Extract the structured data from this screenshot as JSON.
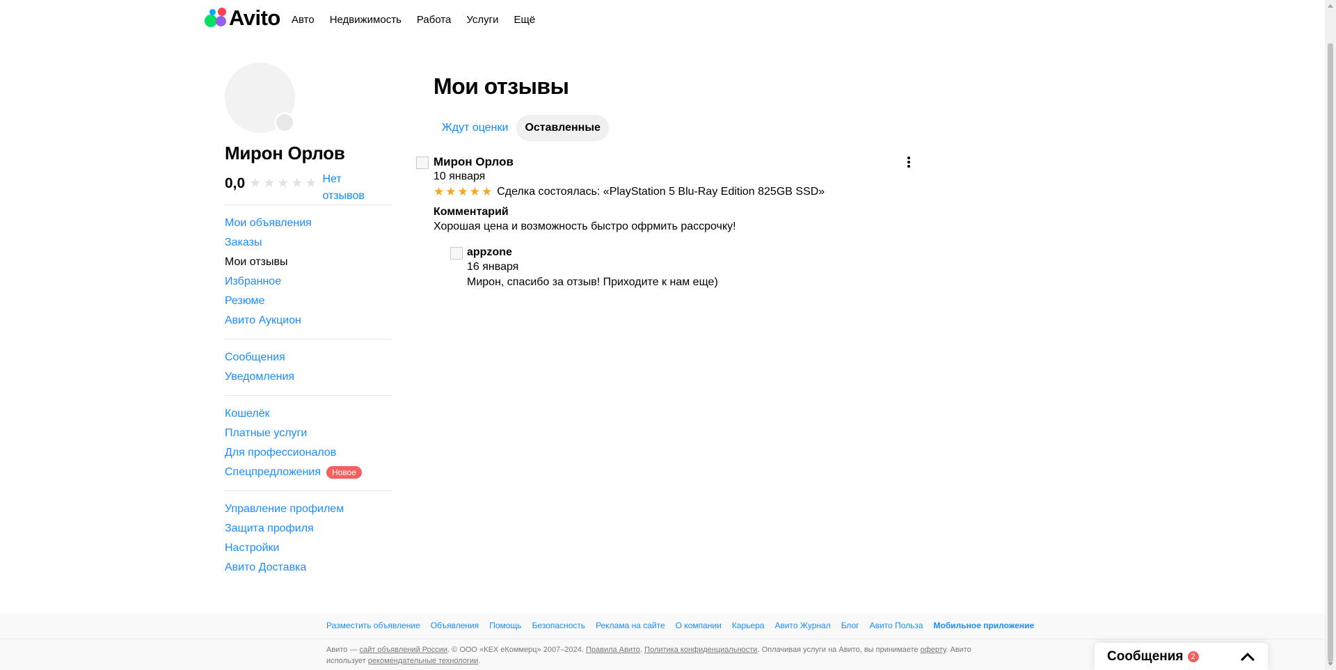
{
  "header": {
    "logo_text": "Avito",
    "nav": [
      "Авто",
      "Недвижимость",
      "Работа",
      "Услуги",
      "Ещё"
    ]
  },
  "profile": {
    "name": "Мирон Орлов",
    "rating": "0,0",
    "rating_stars_filled": 0,
    "no_reviews": "Нет отзывов"
  },
  "sidebar": {
    "groups": [
      [
        "Мои объявления",
        "Заказы",
        "Мои отзывы",
        "Избранное",
        "Резюме",
        "Авито Аукцион"
      ],
      [
        "Сообщения",
        "Уведомления"
      ],
      [
        "Кошелёк",
        "Платные услуги",
        "Для профессионалов",
        "Спецпредложения"
      ],
      [
        "Управление профилем",
        "Защита профиля",
        "Настройки",
        "Авито Доставка"
      ]
    ],
    "active_item": "Мои отзывы",
    "new_badge": "Новое"
  },
  "main": {
    "title": "Мои отзывы",
    "tabs": [
      "Ждут оценки",
      "Оставленные"
    ],
    "selected_tab": "Оставленные",
    "review": {
      "author": "Мирон Орлов",
      "date": "10 января",
      "stars": 5,
      "deal": "Сделка состоялась: «PlayStation 5 Blu-Ray Edition 825GB SSD»",
      "comment_heading": "Комментарий",
      "comment": "Хорошая цена и возможность быстро офрмить рассрочку!",
      "reply": {
        "author": "appzone",
        "date": "16 января",
        "text": "Мирон, спасибо за отзыв! Приходите к нам еще)"
      }
    }
  },
  "footer": {
    "links": [
      "Разместить объявление",
      "Объявления",
      "Помощь",
      "Безопасность",
      "Реклама на сайте",
      "О компании",
      "Карьера",
      "Авито Журнал",
      "Блог",
      "Авито Польза",
      "Мобильное приложение"
    ],
    "legal": {
      "t1": "Авито — ",
      "l1": "сайт объявлений России",
      "t2": ". © ООО «КЕХ еКоммерц» 2007–2024. ",
      "l2": "Правила Авито",
      "t3": ". ",
      "l3": "Политика конфиденциальности",
      "t4": ". Оплачивая услуги на Авито, вы принимаете ",
      "l4": "оферту",
      "t5": ". Авито использует ",
      "l5": "рекомендательные технологии",
      "t6": "."
    }
  },
  "messages": {
    "title": "Сообщения",
    "count": "2"
  },
  "colors": {
    "link": "#1a8cff",
    "badge": "#f45f5f",
    "star": "#f5a623",
    "tab_bg": "#f0f0f0"
  }
}
